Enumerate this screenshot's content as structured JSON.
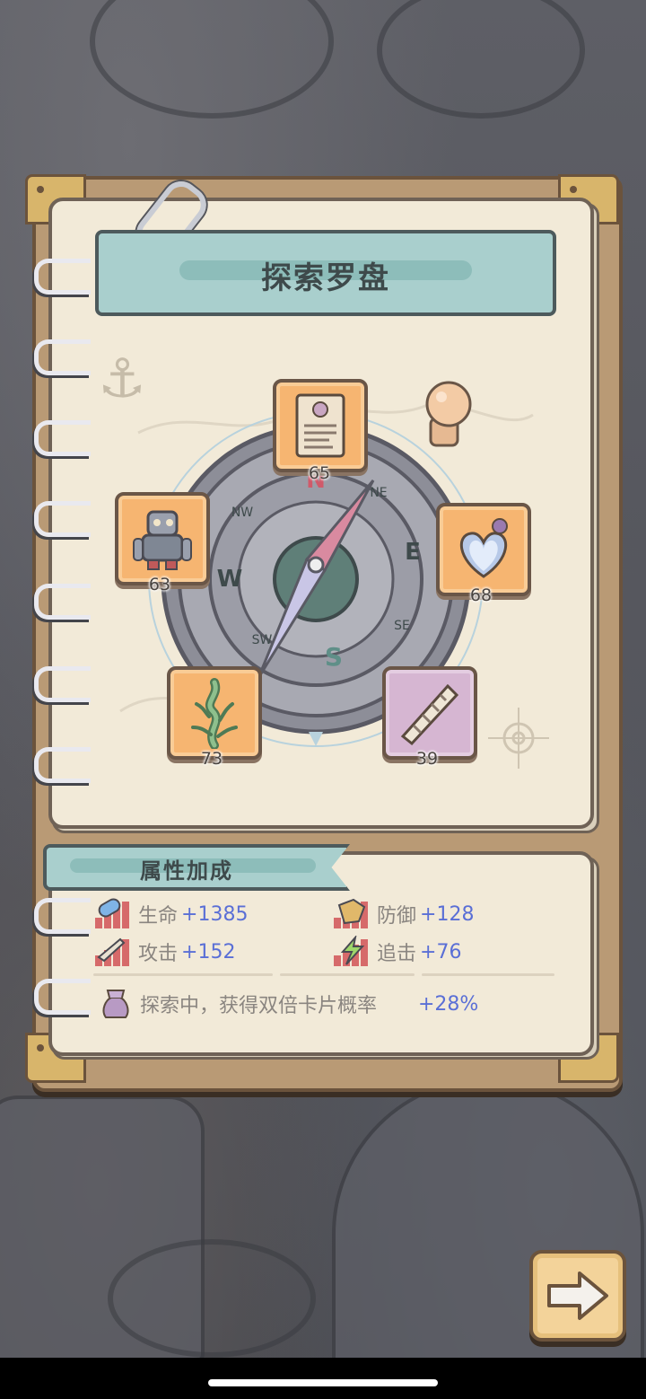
{
  "title": "探索罗盘",
  "compass_letters": {
    "north": "N",
    "east": "E",
    "south": "S",
    "west": "W",
    "ne": "NE",
    "nw": "NW",
    "se": "SE",
    "sw": "SW"
  },
  "cards": [
    {
      "id": "scroll",
      "level": "65",
      "bg": "orange",
      "icon": "scroll-icon"
    },
    {
      "id": "robot",
      "level": "63",
      "bg": "orange",
      "icon": "robot-icon"
    },
    {
      "id": "gem",
      "level": "68",
      "bg": "orange",
      "icon": "heart-gem-icon"
    },
    {
      "id": "seaweed",
      "level": "73",
      "bg": "orange",
      "icon": "seaweed-icon"
    },
    {
      "id": "horn",
      "level": "39",
      "bg": "purple",
      "icon": "horn-icon"
    }
  ],
  "bonus": {
    "title": "属性加成",
    "stats": [
      {
        "label": "生命",
        "value": "+1385",
        "icon": "hp-pill-icon"
      },
      {
        "label": "防御",
        "value": "+128",
        "icon": "shield-icon"
      },
      {
        "label": "攻击",
        "value": "+152",
        "icon": "sword-icon"
      },
      {
        "label": "追击",
        "value": "+76",
        "icon": "lightning-icon"
      }
    ],
    "chance": {
      "label": "探索中，获得双倍卡片概率",
      "value": "+28%",
      "icon": "pouch-icon"
    }
  },
  "colors": {
    "value_blue": "#5a6fd6",
    "slot_orange": "#f6b571",
    "slot_purple": "#d6b6d2",
    "banner_teal": "#a9cfcd",
    "page_cream": "#f2ead8"
  },
  "next_button": {
    "icon": "arrow-right-icon"
  }
}
